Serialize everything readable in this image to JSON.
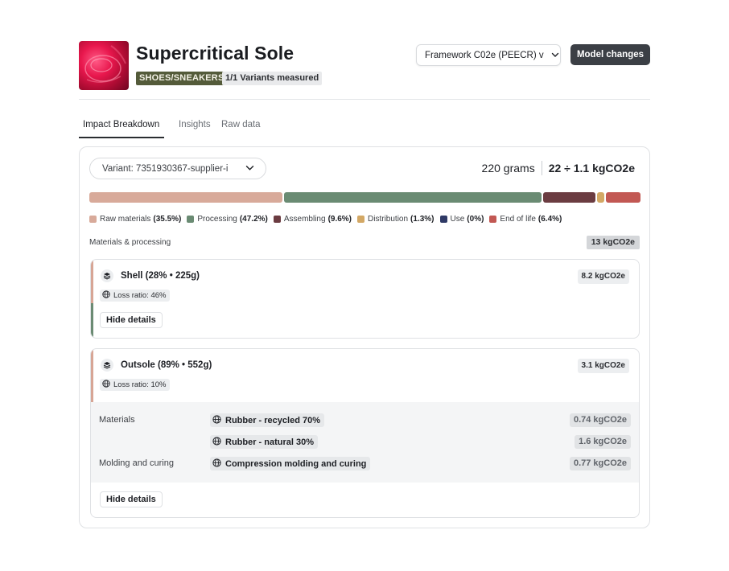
{
  "product": {
    "title": "Supercritical Sole",
    "category": "SHOES/SNEAKERS",
    "variants_measured": "1/1 Variants measured"
  },
  "actions": {
    "framework_label": "Framework C02e (PEECR) v",
    "model_changes_label": "Model changes"
  },
  "tabs": [
    {
      "label": "Impact Breakdown",
      "active": true
    },
    {
      "label": "Insights",
      "active": false
    },
    {
      "label": "Raw data",
      "active": false
    }
  ],
  "breakdown": {
    "variant_label": "Variant: 7351930367-supplier-i",
    "weight": "220 grams",
    "total": "22 ÷ 1.1 kgCO2e",
    "segments": [
      {
        "name": "Raw materials",
        "pct_label": "(35.5%)",
        "share": 35.5,
        "color": "#d8aa9a"
      },
      {
        "name": "Processing",
        "pct_label": "(47.2%)",
        "share": 47.2,
        "color": "#6a8b73"
      },
      {
        "name": "Assembling",
        "pct_label": "(9.6%)",
        "share": 9.6,
        "color": "#6b3c41"
      },
      {
        "name": "Distribution",
        "pct_label": "(1.3%)",
        "share": 1.3,
        "color": "#d3a865"
      },
      {
        "name": "Use",
        "pct_label": "(0%)",
        "share": 0,
        "color": "#2f3a66"
      },
      {
        "name": "End of life",
        "pct_label": "(6.4%)",
        "share": 6.4,
        "color": "#c25853"
      }
    ],
    "section_label": "Materials & processing",
    "section_total": "13 kgCO2e"
  },
  "components": [
    {
      "title": "Shell (28% • 225g)",
      "value": "8.2 kgCO2e",
      "loss_ratio": "Loss ratio: 46%",
      "hide_label": "Hide details"
    },
    {
      "title": "Outsole (89% • 552g)",
      "value": "3.1 kgCO2e",
      "loss_ratio": "Loss ratio: 10%",
      "hide_label": "Hide details",
      "details": {
        "materials_label": "Materials",
        "processing_label": "Molding and curing",
        "rows": [
          {
            "name": "Rubber - recycled 70%",
            "value": "0.74 kgCO2e"
          },
          {
            "name": "Rubber - natural 30%",
            "value": "1.6 kgCO2e"
          },
          {
            "name": "Compression molding and curing",
            "value": "0.77 kgCO2e"
          }
        ]
      }
    }
  ],
  "icons": {
    "chevron": "chevron-down-icon",
    "globe": "globe-icon",
    "layers": "layers-icon"
  }
}
